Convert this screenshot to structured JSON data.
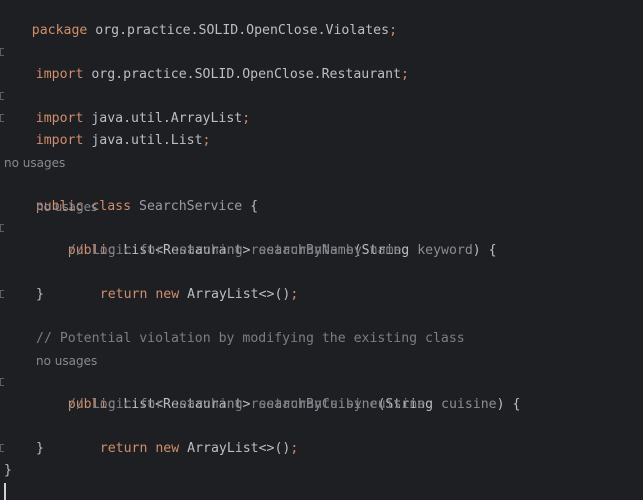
{
  "code": {
    "package_kw": "package",
    "package_name": "org.practice.SOLID.OpenClose.Violates",
    "semicolon": ";",
    "import_kw": "import",
    "import_1": "org.practice.SOLID.OpenClose.Restaurant",
    "import_2": "java.util.ArrayList",
    "import_3": "java.util.List",
    "usage_hint": "no usages",
    "public_kw": "public",
    "class_kw": "class",
    "class_name": "SearchService",
    "open_brace": " {",
    "close_brace": "}",
    "method1": {
      "return_type": "List<Restaurant>",
      "name": "searchByName",
      "paren_open": "(",
      "param_type": "String",
      "param_name": "keyword",
      "paren_close": ") {",
      "comment": "// Logic for searching restaurants by name"
    },
    "return_kw": "return",
    "new_kw": "new",
    "return_expr": "ArrayList<>()",
    "class_comment": "// Potential violation by modifying the existing class",
    "method2": {
      "return_type": "List<Restaurant>",
      "name": "searchByCuisine",
      "paren_open": "(",
      "param_type": "String",
      "param_name": "cuisine",
      "paren_close": ") {",
      "comment": "// Logic for searching restaurants by cuisine"
    }
  },
  "colors": {
    "background": "#1e1f22",
    "keyword": "#cf8e6d",
    "text": "#bcbec4",
    "comment": "#7a7e85",
    "inactive": "#8b8d93"
  }
}
